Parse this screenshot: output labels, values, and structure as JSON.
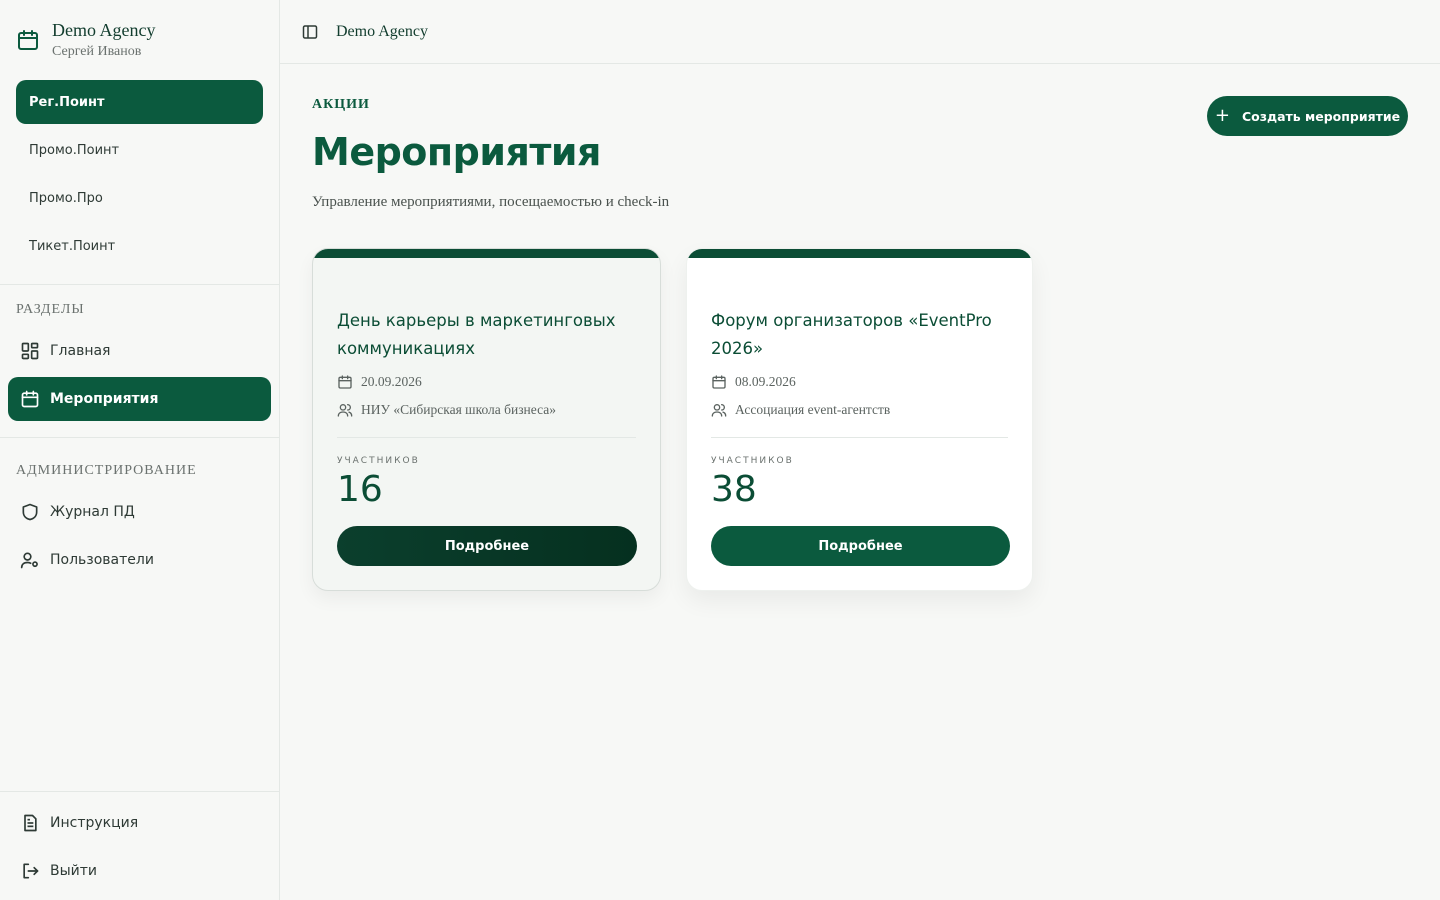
{
  "sidebar": {
    "brand": {
      "title": "Demo Agency",
      "subtitle": "Сергей Иванов",
      "icon": "calendar-icon"
    },
    "products": [
      {
        "label": "Рег.Поинт",
        "active": true
      },
      {
        "label": "Промо.Поинт",
        "active": false
      },
      {
        "label": "Промо.Про",
        "active": false
      },
      {
        "label": "Тикет.Поинт",
        "active": false
      }
    ],
    "sections_title": "РАЗДЕЛЫ",
    "sections": [
      {
        "label": "Главная",
        "icon": "dashboard-icon",
        "active": false
      },
      {
        "label": "Мероприятия",
        "icon": "calendar-icon",
        "active": true
      }
    ],
    "admin_title": "АДМИНИСТРИРОВАНИЕ",
    "admin": [
      {
        "label": "Журнал ПД",
        "icon": "shield-icon"
      },
      {
        "label": "Пользователи",
        "icon": "users-settings-icon"
      }
    ],
    "footer": [
      {
        "label": "Инструкция",
        "icon": "document-icon"
      },
      {
        "label": "Выйти",
        "icon": "logout-icon"
      }
    ]
  },
  "topbar": {
    "title": "Demo Agency",
    "toggle_icon": "sidebar-toggle-icon"
  },
  "main": {
    "eyebrow": "АКЦИИ",
    "title": "Мероприятия",
    "subtitle": "Управление мероприятиями, посещаемостью и check-in",
    "create_button": "Создать мероприятие",
    "events": [
      {
        "title": "День карьеры в маркетинговых коммуникациях",
        "date": "20.09.2026",
        "organizer": "НИУ «Сибирская школа бизнеса»",
        "count_label": "УЧАСТНИКОВ",
        "count": "16",
        "button": "Подробнее"
      },
      {
        "title": "Форум организаторов «EventPro 2026»",
        "date": "08.09.2026",
        "organizer": "Ассоциация event-агентств",
        "count_label": "УЧАСТНИКОВ",
        "count": "38",
        "button": "Подробнее"
      }
    ]
  },
  "colors": {
    "accent": "#0b5a3e",
    "accent_dark": "#0b4d35",
    "background": "#f7f8f6"
  }
}
